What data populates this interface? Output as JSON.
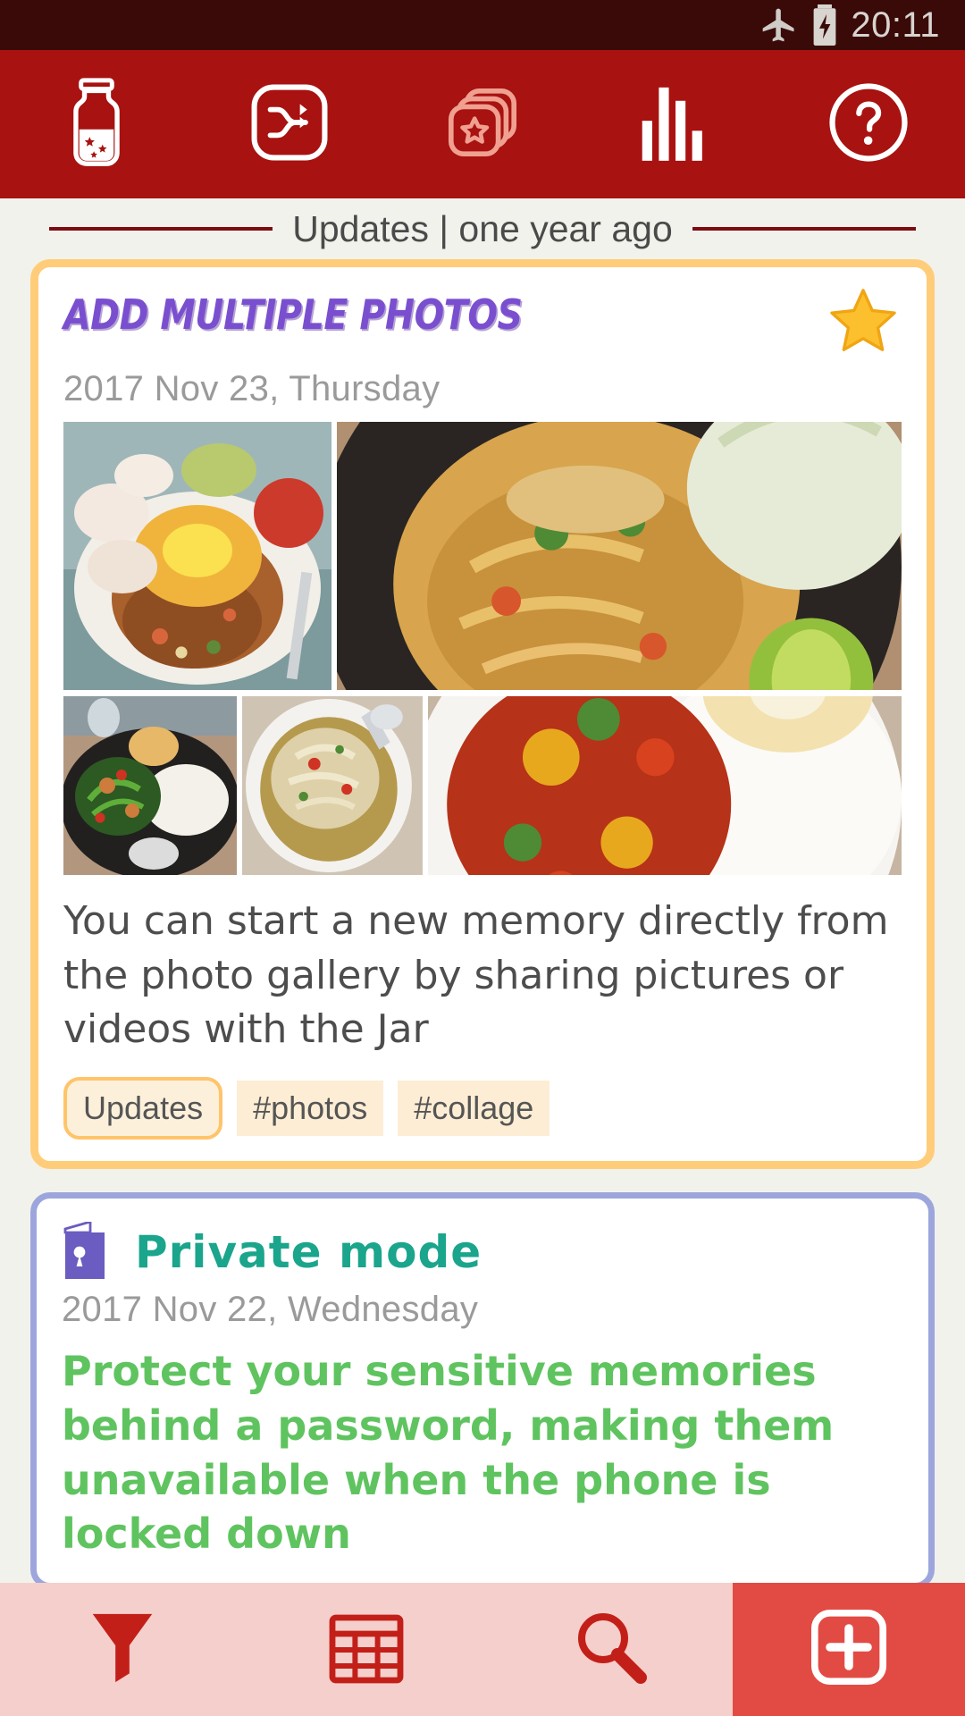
{
  "status_bar": {
    "time": "20:11",
    "icons": [
      "airplane-mode-icon",
      "battery-charging-icon"
    ]
  },
  "colors": {
    "toolbar_red": "#a81210",
    "status_bar": "#3a0a08",
    "page_bg": "#f2f2ec",
    "divider_red": "#7d0c12",
    "updates_card_border": "#ffcd7a",
    "private_card_border": "#9da6dc",
    "title_purple": "#7a4fcf",
    "title_teal": "#1aa58c",
    "private_text_green": "#5fc45f",
    "star_yellow": "#fcbf2e",
    "fab_red": "#e24b44",
    "bottom_bar_pink": "#f5cfcb"
  },
  "toolbar": {
    "items": [
      {
        "name": "jar-icon",
        "label": "Jar"
      },
      {
        "name": "shuffle-icon",
        "label": "Shuffle"
      },
      {
        "name": "cards-star-icon",
        "label": "Collections"
      },
      {
        "name": "bar-chart-icon",
        "label": "Statistics"
      },
      {
        "name": "help-circle-icon",
        "label": "Help"
      }
    ]
  },
  "section_header": {
    "label": "Updates | one year ago"
  },
  "cards": [
    {
      "title": "ADD MULTIPLE PHOTOS",
      "date": "2017 Nov 23, Thursday",
      "starred": true,
      "star_icon": "star-icon",
      "body": "You can start a new memory directly from the photo gallery by sharing pictures or videos with the Jar",
      "photos": [
        {
          "name": "photo-fried-rice-egg",
          "alt": "Fried rice with egg"
        },
        {
          "name": "photo-pad-thai",
          "alt": "Pad thai noodles"
        },
        {
          "name": "photo-stirfry-rice",
          "alt": "Stir fry with rice"
        },
        {
          "name": "photo-chicken-soup",
          "alt": "Chicken soup"
        },
        {
          "name": "photo-sweet-sour-rice",
          "alt": "Sweet and sour with rice"
        }
      ],
      "tags": [
        {
          "label": "Updates",
          "primary": true
        },
        {
          "label": "#photos",
          "primary": false
        },
        {
          "label": "#collage",
          "primary": false
        }
      ]
    },
    {
      "title": "Private mode",
      "date": "2017 Nov 22, Wednesday",
      "icon": "lock-book-icon",
      "body": "Protect your sensitive memories behind a password, making them unavailable when the phone is locked down"
    }
  ],
  "bottom_bar": {
    "items": [
      {
        "name": "filter-funnel-icon",
        "label": "Filter"
      },
      {
        "name": "calendar-icon",
        "label": "Calendar"
      },
      {
        "name": "search-icon",
        "label": "Search"
      }
    ],
    "fab": {
      "name": "add-plus-icon",
      "label": "Add"
    }
  }
}
